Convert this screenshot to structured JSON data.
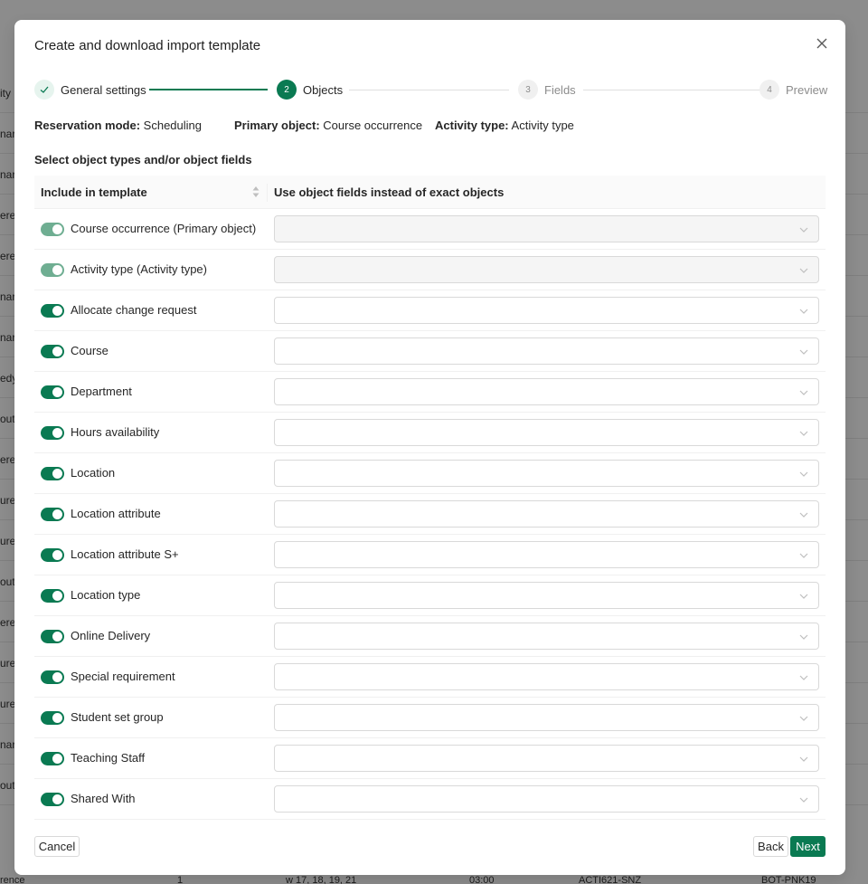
{
  "background": {
    "row_fragments": [
      "ity",
      "nar",
      "nar",
      "ere",
      "ere",
      "nar",
      "nar",
      "edy",
      "out",
      "ere",
      "ure",
      "ure",
      "out",
      "ere",
      "ure",
      "ure",
      "nar",
      "out"
    ],
    "bottom_row": [
      "rence",
      "1",
      "w 17, 18, 19, 21",
      "03:00",
      "ACTI621-SNZ",
      "BOT-PNK19"
    ]
  },
  "modal": {
    "title": "Create and download import template",
    "close_icon": "close-icon"
  },
  "steps": [
    {
      "number": "1",
      "label": "General settings",
      "status": "done"
    },
    {
      "number": "2",
      "label": "Objects",
      "status": "active"
    },
    {
      "number": "3",
      "label": "Fields",
      "status": "waiting"
    },
    {
      "number": "4",
      "label": "Preview",
      "status": "waiting"
    }
  ],
  "meta": {
    "reservation_mode_key": "Reservation mode:",
    "reservation_mode_value": "Scheduling",
    "primary_object_key": "Primary object:",
    "primary_object_value": "Course occurrence",
    "activity_type_key": "Activity type:",
    "activity_type_value": "Activity type"
  },
  "section_label": "Select object types and/or object fields",
  "table": {
    "col_include": "Include in template",
    "col_fields": "Use object fields instead of exact objects",
    "rows": [
      {
        "label": "Course occurrence (Primary object)",
        "enabled": true,
        "disabled": true
      },
      {
        "label": "Activity type (Activity type)",
        "enabled": true,
        "disabled": true
      },
      {
        "label": "Allocate change request",
        "enabled": true,
        "disabled": false
      },
      {
        "label": "Course",
        "enabled": true,
        "disabled": false
      },
      {
        "label": "Department",
        "enabled": true,
        "disabled": false
      },
      {
        "label": "Hours availability",
        "enabled": true,
        "disabled": false
      },
      {
        "label": "Location",
        "enabled": true,
        "disabled": false
      },
      {
        "label": "Location attribute",
        "enabled": true,
        "disabled": false
      },
      {
        "label": "Location attribute S+",
        "enabled": true,
        "disabled": false
      },
      {
        "label": "Location type",
        "enabled": true,
        "disabled": false
      },
      {
        "label": "Online Delivery",
        "enabled": true,
        "disabled": false
      },
      {
        "label": "Special requirement",
        "enabled": true,
        "disabled": false
      },
      {
        "label": "Student set group",
        "enabled": true,
        "disabled": false
      },
      {
        "label": "Teaching Staff",
        "enabled": true,
        "disabled": false
      },
      {
        "label": "Shared With",
        "enabled": true,
        "disabled": false
      }
    ]
  },
  "footer": {
    "cancel": "Cancel",
    "back": "Back",
    "next": "Next"
  },
  "colors": {
    "accent": "#0a7a52",
    "accent_disabled": "#6fae92"
  }
}
